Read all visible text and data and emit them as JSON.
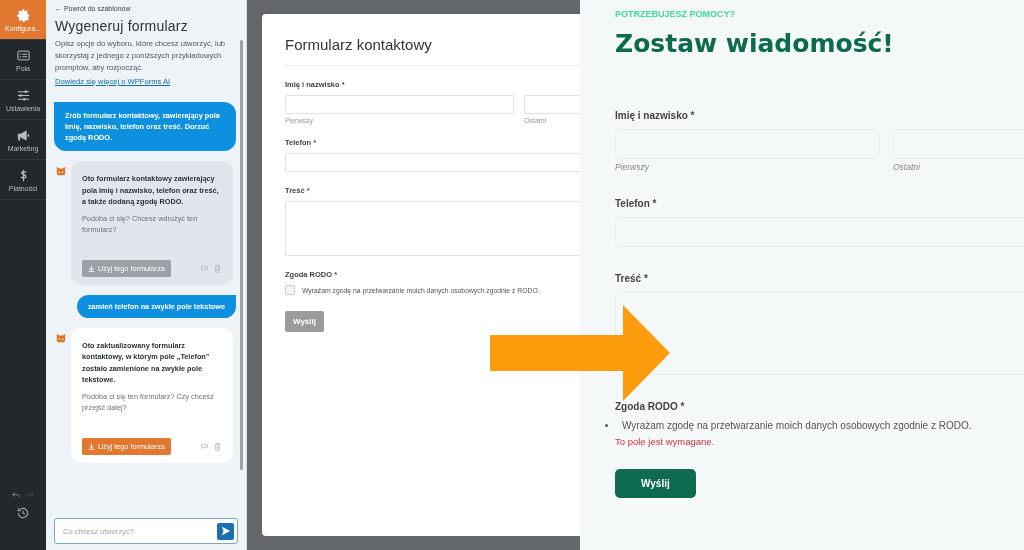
{
  "nav": {
    "items": [
      {
        "kind": "gear",
        "label": "Konfigura...",
        "selected": true
      },
      {
        "kind": "fields",
        "label": "Pola",
        "selected": false
      },
      {
        "kind": "sliders",
        "label": "Ustawienia",
        "selected": false
      },
      {
        "kind": "megaphone",
        "label": "Marketing",
        "selected": false
      },
      {
        "kind": "dollar",
        "label": "Płatności",
        "selected": false
      }
    ]
  },
  "chat": {
    "back_link": "← Powrót do szablonów",
    "title": "Wygeneruj formularz",
    "description": "Opisz opcje do wyboru, które chcesz utworzyć, lub skorzystaj z jednego z poniższych przykładowych promptów, aby rozpocząć.",
    "learn_more_link": "Dowiedz się więcej o WPForms AI",
    "messages": [
      {
        "kind": "user",
        "text": "Zrób formularz kontaktowy, zawierający pola Imię, nazwisko, telefon oraz treść. Dorzuć zgodę RODO."
      },
      {
        "kind": "assistant",
        "active": false,
        "text": "Oto formularz kontaktowy zawierający pola Imię i nazwisko, telefon oraz treść, a także dodaną zgodę RODO.",
        "question": "Podoba ci się? Chcesz wdrożyć ten formularz?",
        "button": {
          "label": "Użyj tego formularza",
          "disabled": true
        }
      },
      {
        "kind": "user",
        "text": "zamień telefon na zwykłe pole tekstowe"
      },
      {
        "kind": "assistant",
        "active": true,
        "text": "Oto zaktualizowany formularz kontaktowy, w którym pole „Telefon\" zostało zamienione na zwykłe pole tekstowe.",
        "question": "Podoba ci się ten formularz? Czy chcesz przejść dalej?",
        "button": {
          "label": "Użyj tego formularza",
          "disabled": false
        }
      }
    ],
    "input": {
      "placeholder": "Co chcesz utworzyć?"
    }
  },
  "preview": {
    "title": "Formularz kontaktowy",
    "fields": [
      {
        "kind": "name",
        "label": "Imię i nazwisko *",
        "sublabels": [
          "Pierwszy",
          "Ostatni"
        ]
      },
      {
        "kind": "text",
        "label": "Telefon *"
      },
      {
        "kind": "textarea",
        "label": "Treść *"
      },
      {
        "kind": "checkbox",
        "label": "Zgoda RODO *",
        "option": "Wyrażam zgodę na przetwarzanie moich danych osobowych zgodnie z RODO.",
        "checked": false
      }
    ],
    "submit": {
      "label": "Wyślij",
      "disabled": true
    }
  },
  "live": {
    "eyebrow": "POTRZEBUJESZ POMOCY?",
    "title": "Zostaw wiadomość!",
    "fields": [
      {
        "kind": "name",
        "label": "Imię i nazwisko *",
        "sublabels": [
          "Pierwszy",
          "Ostatni"
        ]
      },
      {
        "kind": "text",
        "label": "Telefon *"
      },
      {
        "kind": "textarea",
        "label": "Treść *"
      },
      {
        "kind": "bullet",
        "label": "Zgoda RODO *",
        "option": "Wyrażam zgodę na przetwarzanie moich danych osobowych zgodnie z RODO.",
        "error": "To pole jest wymagane."
      }
    ],
    "submit": {
      "label": "Wyślij",
      "disabled": false
    }
  }
}
